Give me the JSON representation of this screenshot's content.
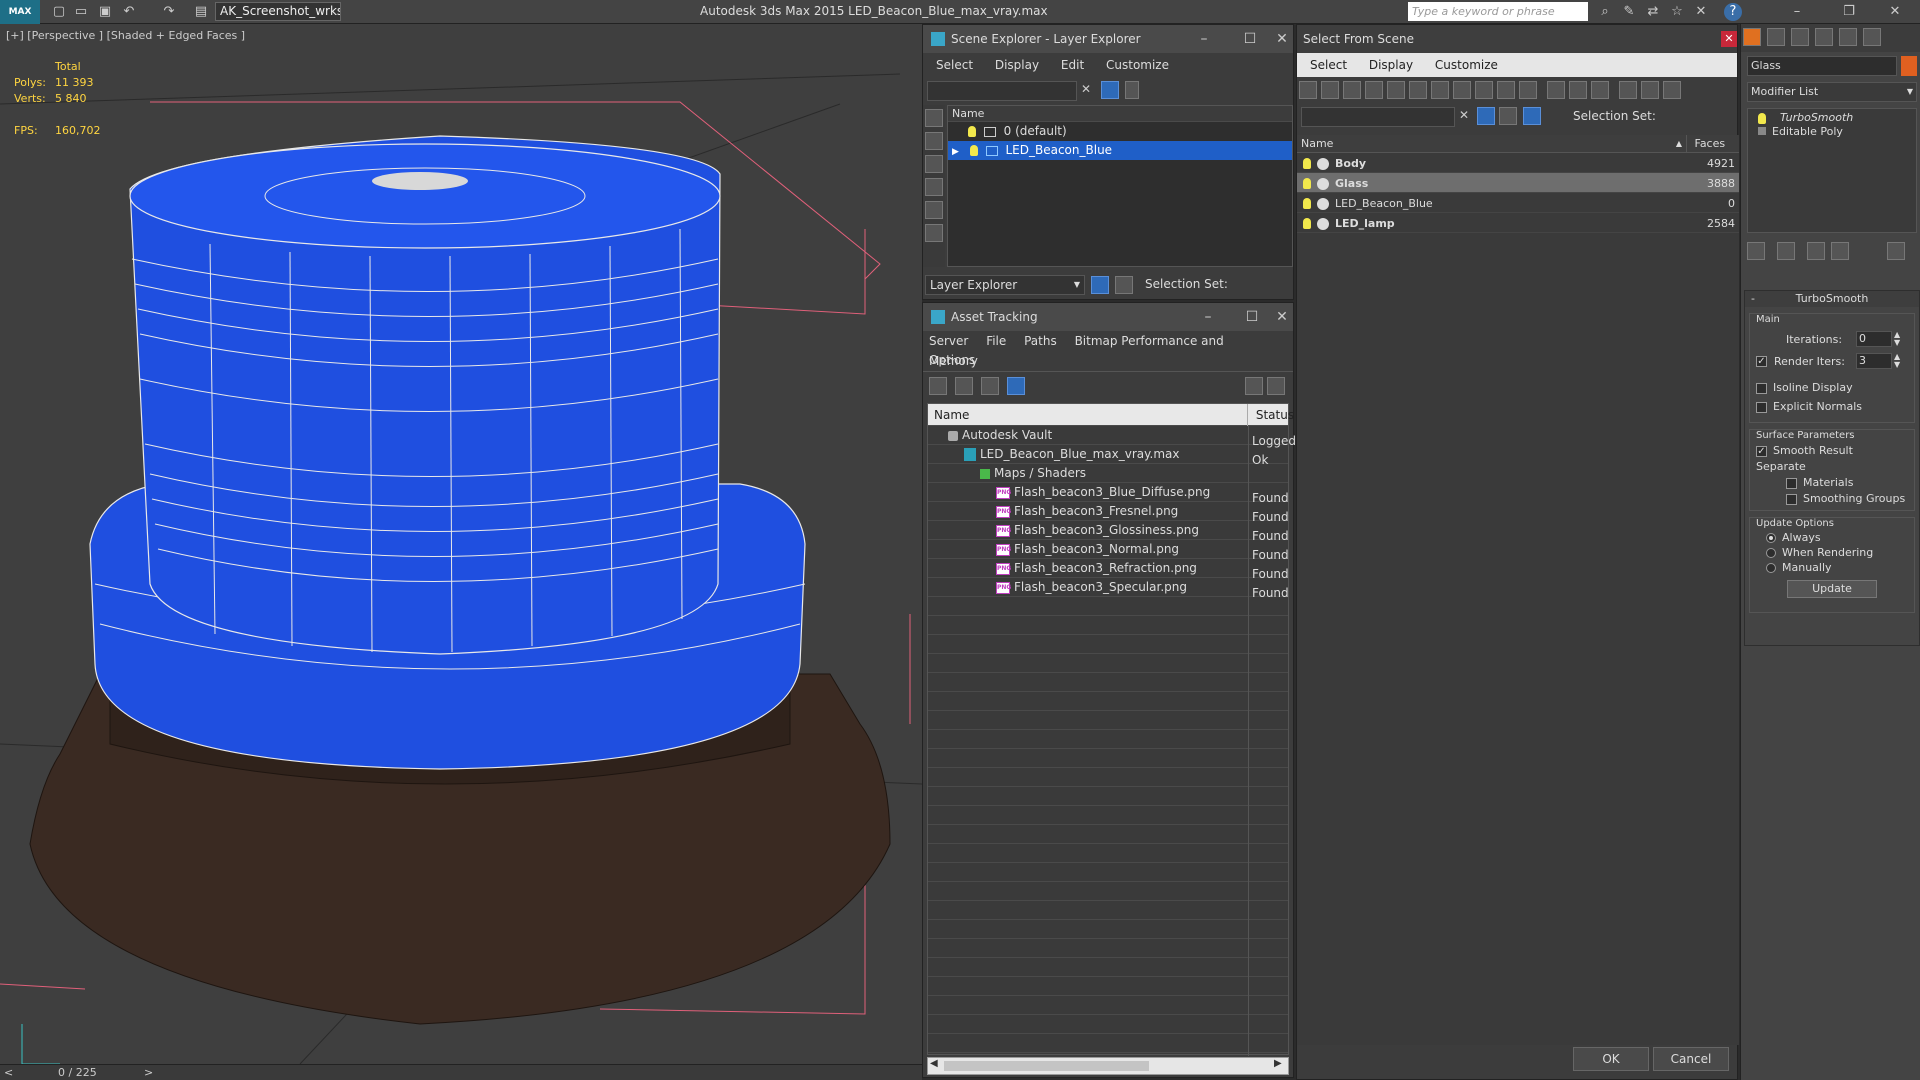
{
  "app": {
    "title": "Autodesk 3ds Max  2015    LED_Beacon_Blue_max_vray.max",
    "workspace": "AK_Screenshot_wrksp",
    "search_placeholder": "Type a keyword or phrase",
    "logo_label": "MAX"
  },
  "viewport": {
    "label": "[+] [Perspective ] [Shaded + Edged Faces ]",
    "stats": {
      "total_label": "Total",
      "polys_label": "Polys:",
      "polys_value": "11 393",
      "verts_label": "Verts:",
      "verts_value": "5 840",
      "fps_label": "FPS:",
      "fps_value": "160,702"
    },
    "timeline": {
      "prev": "<",
      "frame": "0 / 225",
      "next": ">"
    }
  },
  "scene_explorer": {
    "title": "Scene Explorer - Layer Explorer",
    "menu": [
      "Select",
      "Display",
      "Edit",
      "Customize"
    ],
    "column_name": "Name",
    "rows": [
      {
        "label": "0 (default)",
        "selected": false
      },
      {
        "label": "LED_Beacon_Blue",
        "selected": true
      }
    ],
    "footer_dropdown": "Layer Explorer",
    "selection_set_label": "Selection Set:"
  },
  "asset_tracking": {
    "title": "Asset Tracking",
    "menu_row1": [
      "Server",
      "File",
      "Paths",
      "Bitmap Performance and Memory"
    ],
    "menu_row2": [
      "Options"
    ],
    "col_name": "Name",
    "col_status": "Status",
    "rows": [
      {
        "name": "Autodesk Vault",
        "status": "Logged",
        "indent": 1,
        "icon": "vault"
      },
      {
        "name": "LED_Beacon_Blue_max_vray.max",
        "status": "Ok",
        "indent": 2,
        "icon": "max"
      },
      {
        "name": "Maps / Shaders",
        "status": "",
        "indent": 3,
        "icon": "maps"
      },
      {
        "name": "Flash_beacon3_Blue_Diffuse.png",
        "status": "Found",
        "indent": 4,
        "icon": "png"
      },
      {
        "name": "Flash_beacon3_Fresnel.png",
        "status": "Found",
        "indent": 4,
        "icon": "png"
      },
      {
        "name": "Flash_beacon3_Glossiness.png",
        "status": "Found",
        "indent": 4,
        "icon": "png"
      },
      {
        "name": "Flash_beacon3_Normal.png",
        "status": "Found",
        "indent": 4,
        "icon": "png"
      },
      {
        "name": "Flash_beacon3_Refraction.png",
        "status": "Found",
        "indent": 4,
        "icon": "png"
      },
      {
        "name": "Flash_beacon3_Specular.png",
        "status": "Found",
        "indent": 4,
        "icon": "png"
      }
    ],
    "png_badge": "PNG"
  },
  "select_from_scene": {
    "title": "Select From Scene",
    "menu": [
      "Select",
      "Display",
      "Customize"
    ],
    "selection_set_label": "Selection Set:",
    "col_name": "Name",
    "col_faces": "Faces",
    "rows": [
      {
        "name": "Body",
        "faces": "4921",
        "bold": true,
        "selected": false
      },
      {
        "name": "Glass",
        "faces": "3888",
        "bold": true,
        "selected": true
      },
      {
        "name": "LED_Beacon_Blue",
        "faces": "0",
        "bold": false,
        "selected": false
      },
      {
        "name": "LED_lamp",
        "faces": "2584",
        "bold": true,
        "selected": false
      }
    ],
    "ok_label": "OK",
    "cancel_label": "Cancel"
  },
  "command_panel": {
    "object_name": "Glass",
    "modifier_list": "Modifier List",
    "stack": [
      {
        "label": "TurboSmooth",
        "italic": true
      },
      {
        "label": "Editable Poly",
        "italic": false
      }
    ],
    "rollout_title": "TurboSmooth",
    "main_group": "Main",
    "iterations_label": "Iterations:",
    "iterations_value": "0",
    "render_iters_label": "Render Iters:",
    "render_iters_value": "3",
    "isoline_label": "Isoline Display",
    "explicit_normals_label": "Explicit Normals",
    "surface_group": "Surface Parameters",
    "smooth_result_label": "Smooth Result",
    "separate_label": "Separate",
    "materials_label": "Materials",
    "smoothing_groups_label": "Smoothing Groups",
    "update_group": "Update Options",
    "always_label": "Always",
    "when_rendering_label": "When Rendering",
    "manually_label": "Manually",
    "update_button": "Update"
  }
}
